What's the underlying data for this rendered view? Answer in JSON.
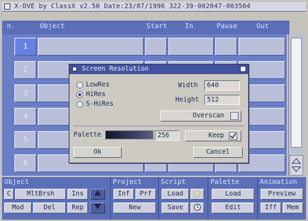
{
  "app": {
    "title": "X-DVE by ClassX v2.50 Date:23/07/1996 322-39-002047-003504"
  },
  "columns": {
    "n": "n.",
    "object": "Object",
    "start": "Start",
    "in": "In",
    "pause": "Pause",
    "out": "Out"
  },
  "rows": [
    "1",
    "2",
    "3",
    "4",
    "5",
    "6"
  ],
  "selected_row": "1",
  "dialog": {
    "title": "Screen Resolution",
    "resolutions": [
      "LowRes",
      "HiRes",
      "S-HiRes"
    ],
    "selected_resolution": "HiRes",
    "width_label": "Width",
    "width_value": "640",
    "height_label": "Height",
    "height_value": "512",
    "overscan_label": "Overscan",
    "overscan_checked": false,
    "palette_label": "Palette",
    "palette_value": "256",
    "keep_label": "Keep",
    "keep_checked": true,
    "ok_label": "Ok",
    "cancel_label": "Cancel"
  },
  "panels": {
    "object": {
      "title": "Object",
      "buttons": [
        "MltBrsh",
        "Ins",
        "Mod",
        "Del",
        "Rep"
      ],
      "c_label": "C"
    },
    "project": {
      "title": "Project",
      "buttons": [
        "Inf",
        "Prf",
        "New"
      ]
    },
    "script": {
      "title": "Script",
      "buttons": [
        "Load",
        "Save"
      ]
    },
    "palette": {
      "title": "Palette",
      "buttons": [
        "Load",
        "Edit"
      ]
    },
    "animation": {
      "title": "Animation",
      "buttons": [
        "Preview",
        "Iff",
        "Mem"
      ]
    }
  },
  "colors": {
    "header_blue": "#5b6fb8",
    "row_blue": "#6a7ec7",
    "selected_cell": "#6680e4",
    "dialog_title": "#4253a0",
    "dialog_bg": "#cdcac3"
  }
}
